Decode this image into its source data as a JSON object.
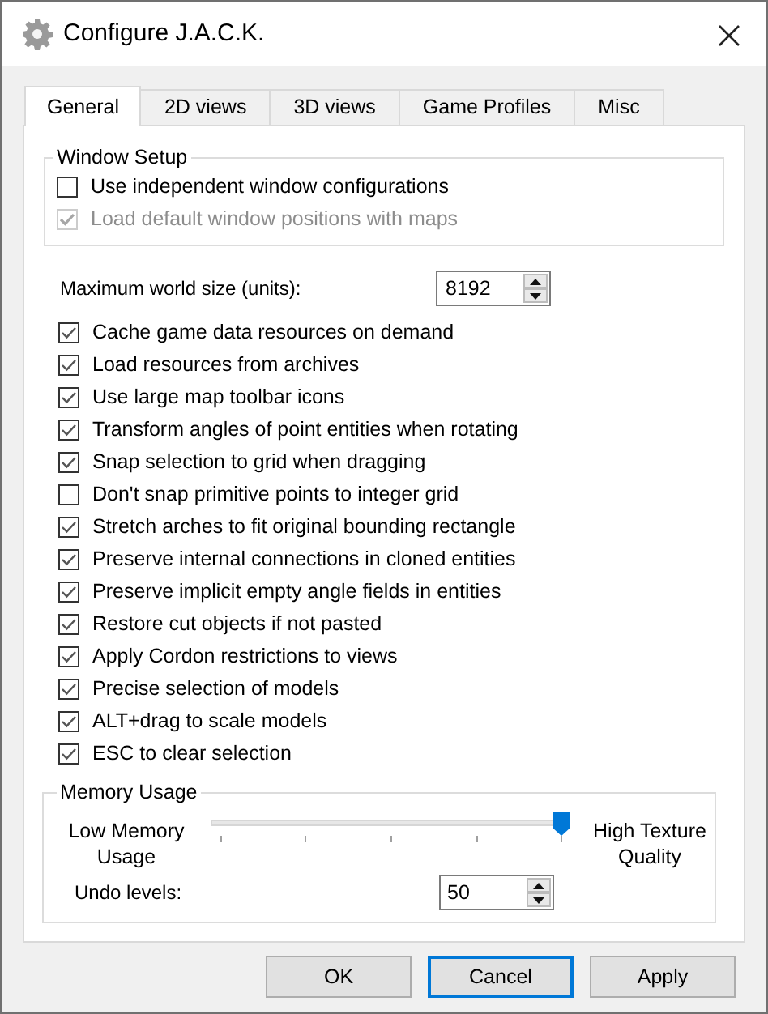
{
  "window": {
    "title": "Configure J.A.C.K."
  },
  "tabs": [
    {
      "label": "General",
      "selected": true
    },
    {
      "label": "2D views",
      "selected": false
    },
    {
      "label": "3D views",
      "selected": false
    },
    {
      "label": "Game Profiles",
      "selected": false
    },
    {
      "label": "Misc",
      "selected": false
    }
  ],
  "window_setup": {
    "title": "Window Setup",
    "options": [
      {
        "label": "Use independent window configurations",
        "checked": false,
        "disabled": false
      },
      {
        "label": "Load default window positions with maps",
        "checked": true,
        "disabled": true
      }
    ]
  },
  "max_world_size": {
    "label": "Maximum world size (units):",
    "value": "8192"
  },
  "options": [
    {
      "label": "Cache game data resources on demand",
      "checked": true
    },
    {
      "label": "Load resources from archives",
      "checked": true
    },
    {
      "label": "Use large map toolbar icons",
      "checked": true
    },
    {
      "label": "Transform angles of point entities when rotating",
      "checked": true
    },
    {
      "label": "Snap selection to grid when dragging",
      "checked": true
    },
    {
      "label": "Don't snap primitive points to integer grid",
      "checked": false
    },
    {
      "label": "Stretch arches to fit original bounding rectangle",
      "checked": true
    },
    {
      "label": "Preserve internal connections in cloned entities",
      "checked": true
    },
    {
      "label": "Preserve implicit empty angle fields in entities",
      "checked": true
    },
    {
      "label": "Restore cut objects if not pasted",
      "checked": true
    },
    {
      "label": "Apply Cordon restrictions to views",
      "checked": true
    },
    {
      "label": "Precise selection of models",
      "checked": true
    },
    {
      "label": "ALT+drag to scale models",
      "checked": true
    },
    {
      "label": "ESC to clear selection",
      "checked": true
    }
  ],
  "memory_usage": {
    "title": "Memory Usage",
    "low_label": "Low Memory Usage",
    "high_label": "High Texture Quality",
    "slider": {
      "level": 1
    },
    "undo_label": "Undo levels:",
    "undo_value": "50"
  },
  "buttons": [
    {
      "label": "OK",
      "focused": false
    },
    {
      "label": "Cancel",
      "focused": true
    },
    {
      "label": "Apply",
      "focused": false
    }
  ]
}
